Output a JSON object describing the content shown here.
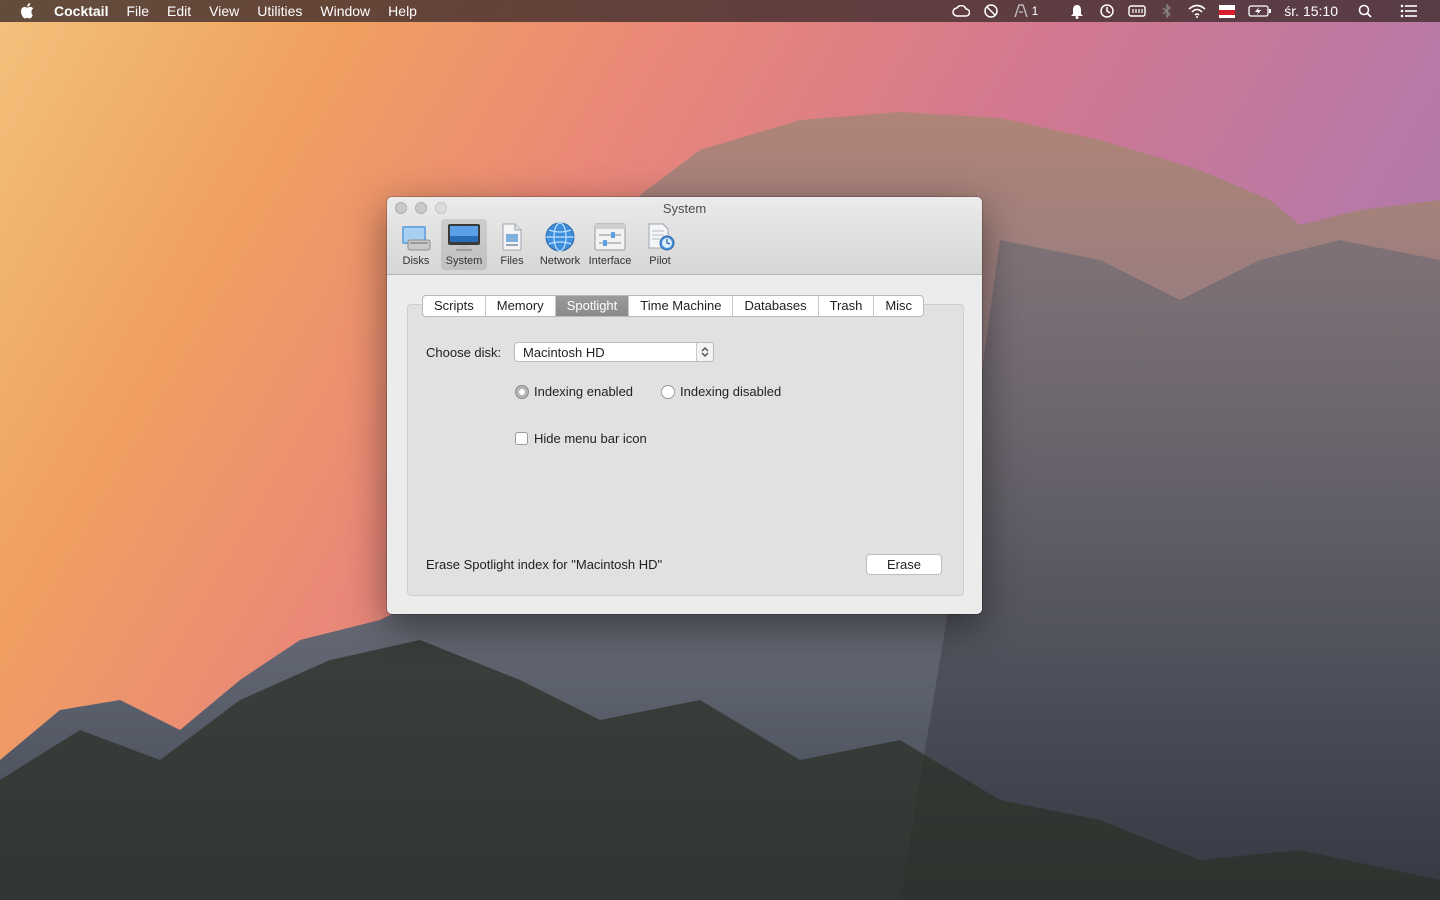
{
  "menubar": {
    "app_name": "Cocktail",
    "items": [
      "File",
      "Edit",
      "View",
      "Utilities",
      "Window",
      "Help"
    ],
    "status": {
      "badge_count": "1",
      "clock": "śr. 15:10"
    }
  },
  "window": {
    "title": "System",
    "toolbar": [
      {
        "label": "Disks",
        "icon": "disks-icon"
      },
      {
        "label": "System",
        "icon": "system-icon"
      },
      {
        "label": "Files",
        "icon": "files-icon"
      },
      {
        "label": "Network",
        "icon": "network-icon"
      },
      {
        "label": "Interface",
        "icon": "interface-icon"
      },
      {
        "label": "Pilot",
        "icon": "pilot-icon"
      }
    ],
    "tabs": [
      "Scripts",
      "Memory",
      "Spotlight",
      "Time Machine",
      "Databases",
      "Trash",
      "Misc"
    ],
    "active_tab": "Spotlight",
    "choose_disk_label": "Choose disk:",
    "selected_disk": "Macintosh HD",
    "radio_enabled": "Indexing enabled",
    "radio_disabled": "Indexing disabled",
    "hide_icon_label": "Hide menu bar icon",
    "erase_text": "Erase Spotlight index for \"Macintosh HD\"",
    "erase_button": "Erase"
  }
}
